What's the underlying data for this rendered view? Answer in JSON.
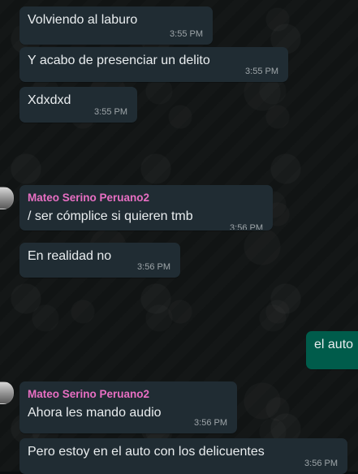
{
  "messages": [
    {
      "text": "Volviendo al laburo",
      "time": "3:55 PM"
    },
    {
      "text": "Y acabo de presenciar un delito",
      "time": "3:55 PM"
    },
    {
      "text": "Xdxdxd",
      "time": "3:55 PM"
    },
    {
      "sender": "Mateo Serino Peruano2",
      "text": "/ ser cómplice si quieren tmb",
      "time": "3:56 PM"
    },
    {
      "text": "En realidad no",
      "time": "3:56 PM"
    },
    {
      "text": "el auto",
      "direction": "outgoing"
    },
    {
      "sender": "Mateo Serino Peruano2",
      "text": "Ahora les mando audio",
      "time": "3:56 PM"
    },
    {
      "text": "Pero estoy en el auto con los delicuentes",
      "time": "3:56 PM"
    }
  ],
  "colors": {
    "sender_name": "#e86fc3",
    "incoming_bubble": "#202c33",
    "outgoing_bubble": "#005c4b",
    "background": "#111414"
  }
}
